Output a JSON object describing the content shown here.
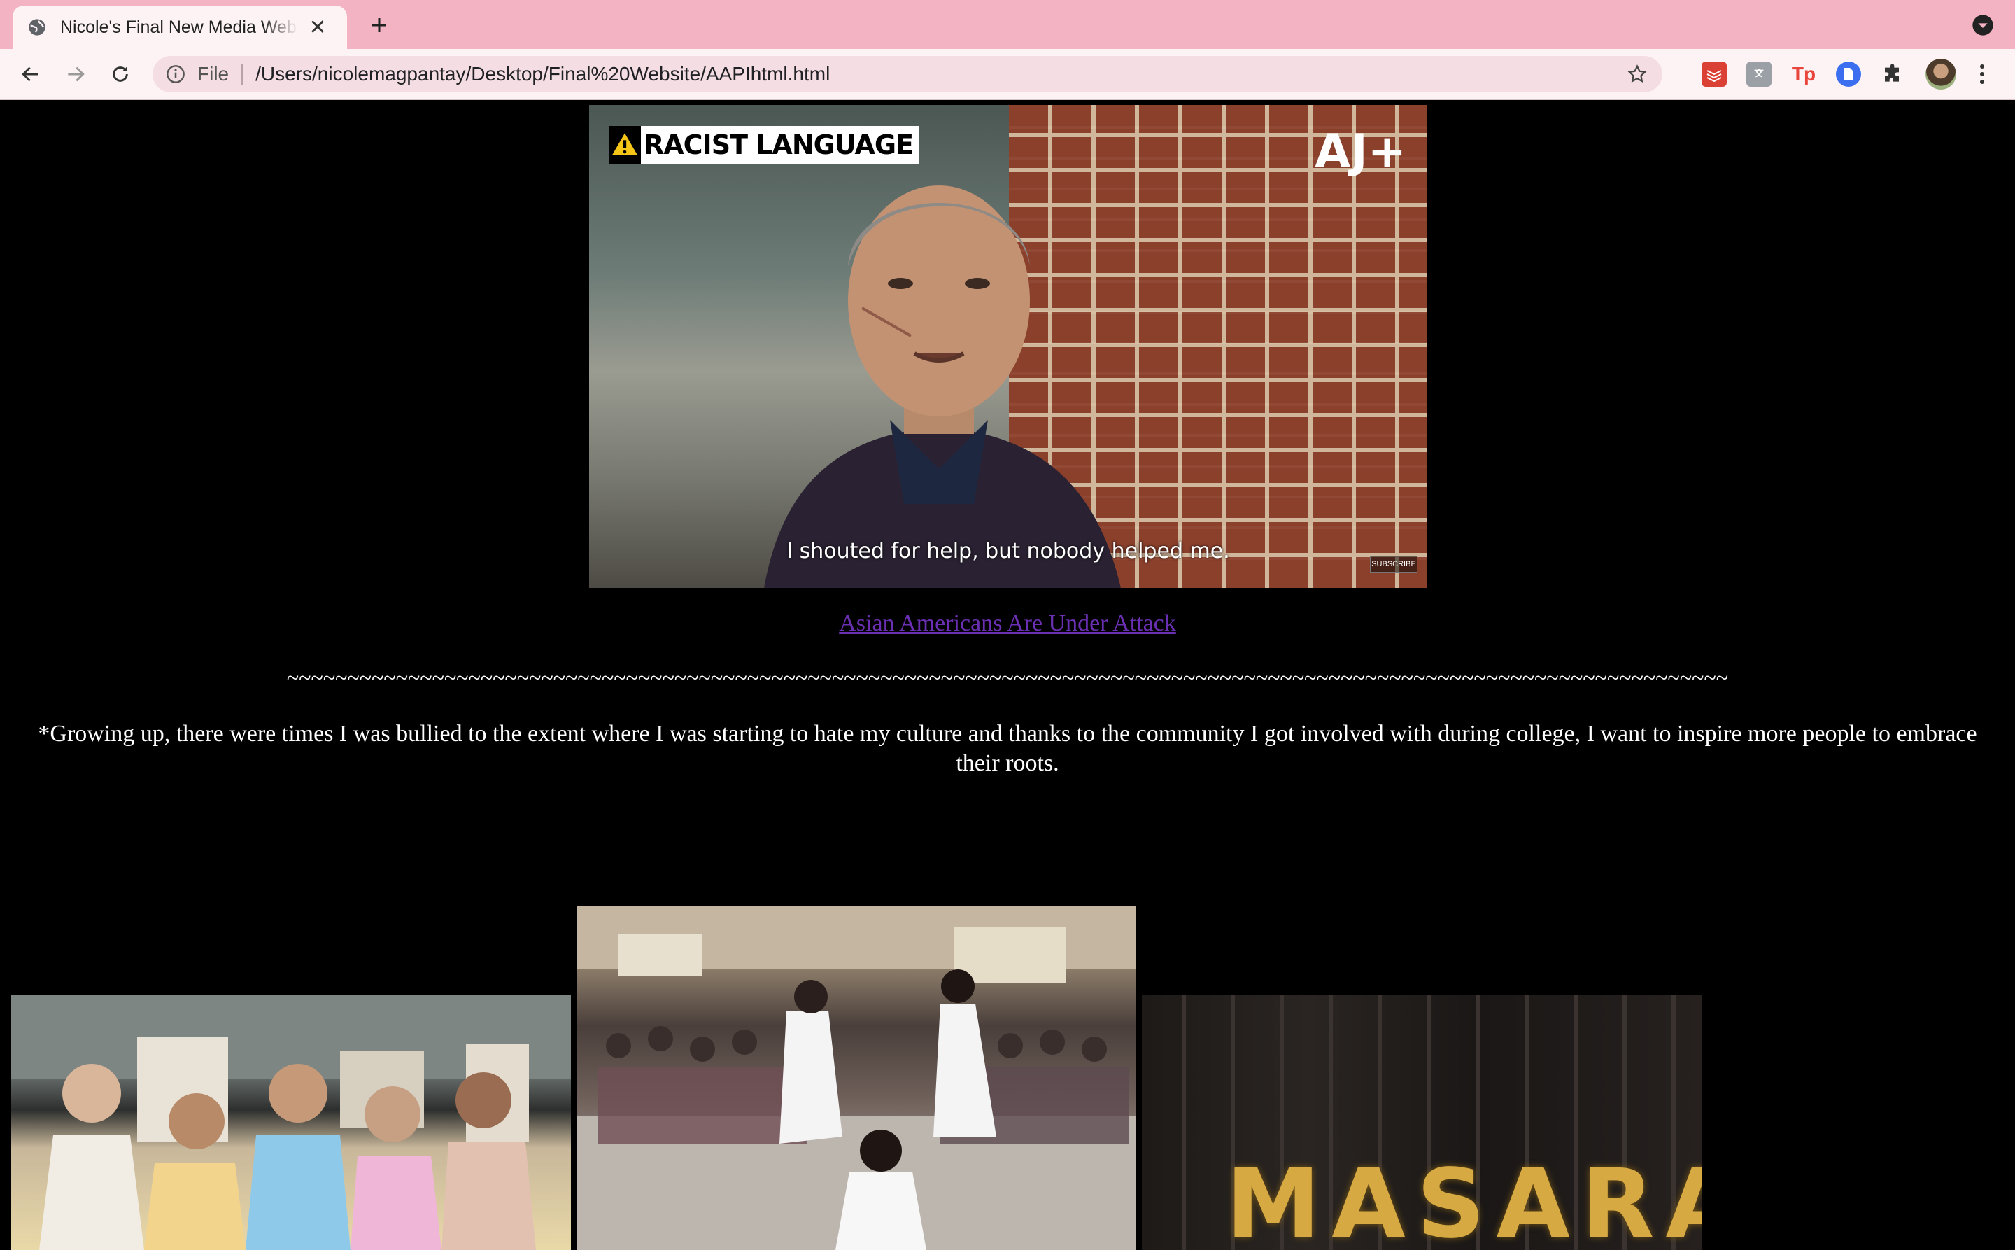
{
  "browser": {
    "tab_title": "Nicole's Final New Media Website",
    "close_symbol": "✕",
    "new_tab_symbol": "+",
    "omnibox": {
      "scheme_label": "File",
      "url": "/Users/nicolemagpantay/Desktop/Final%20Website/AAPIhtml.html"
    },
    "extensions": [
      {
        "name": "todoist-extension-icon",
        "label": "",
        "color": "#db4035"
      },
      {
        "name": "translate-extension-icon",
        "label": "",
        "color": "#9aa0a6"
      },
      {
        "name": "tp-extension-icon",
        "label": "Tp",
        "color": "#e8453c"
      },
      {
        "name": "blue-extension-icon",
        "label": "",
        "color": "#3c6ff0"
      },
      {
        "name": "puzzle-extensions-icon",
        "label": "",
        "color": "#333333"
      }
    ]
  },
  "video": {
    "warning_label": "RACIST LANGUAGE",
    "logo_text": "AJ+",
    "caption": "I shouted for help, but nobody helped me.",
    "subscribe_label": "SUBSCRIBE"
  },
  "page": {
    "link_text": "Asian Americans Are Under Attack",
    "divider": "~~~~~~~~~~~~~~~~~~~~~~~~~~~~~~~~~~~~~~~~~~~~~~~~~~~~~~~~~~~~~~~~~~~~~~~~~~~~~~~~~~~~~~~~~~~~~~~~~~~~~~~~~~~~~~~~~~~~~~~",
    "story": "*Growing up, there were times I was bullied to the extent where I was starting to hate my culture and thanks to the community I got involved with during college, I want to inspire more people to embrace their roots."
  },
  "photos": {
    "third_sign": "MASARAP"
  },
  "colors": {
    "tab_strip": "#f3b3c3",
    "toolbar": "#fdf3f5",
    "page_background": "#000000",
    "link": "#6a2fb2"
  }
}
